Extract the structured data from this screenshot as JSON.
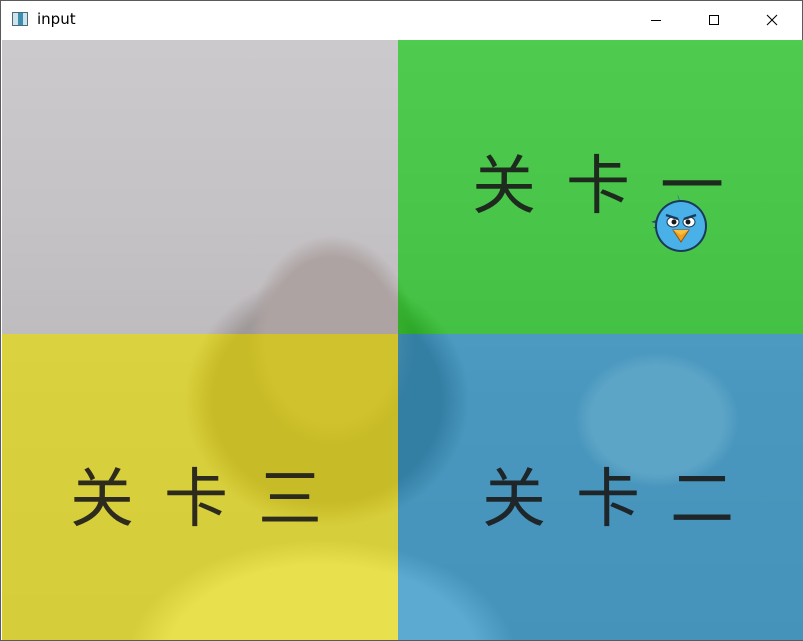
{
  "window": {
    "title": "input",
    "app_icon": "window-app-icon",
    "controls": [
      "minimize-icon",
      "maximize-icon",
      "close-icon"
    ]
  },
  "levels": {
    "level_1": "关卡一",
    "level_2": "关卡二",
    "level_3": "关卡三"
  },
  "regions": {
    "top_left_color": "#c8c3c8",
    "top_right_color": "#28c828",
    "bottom_left_color": "#e6dc28",
    "bottom_right_color": "#3296c8"
  },
  "cursor_sprite": "blue-bird-icon"
}
